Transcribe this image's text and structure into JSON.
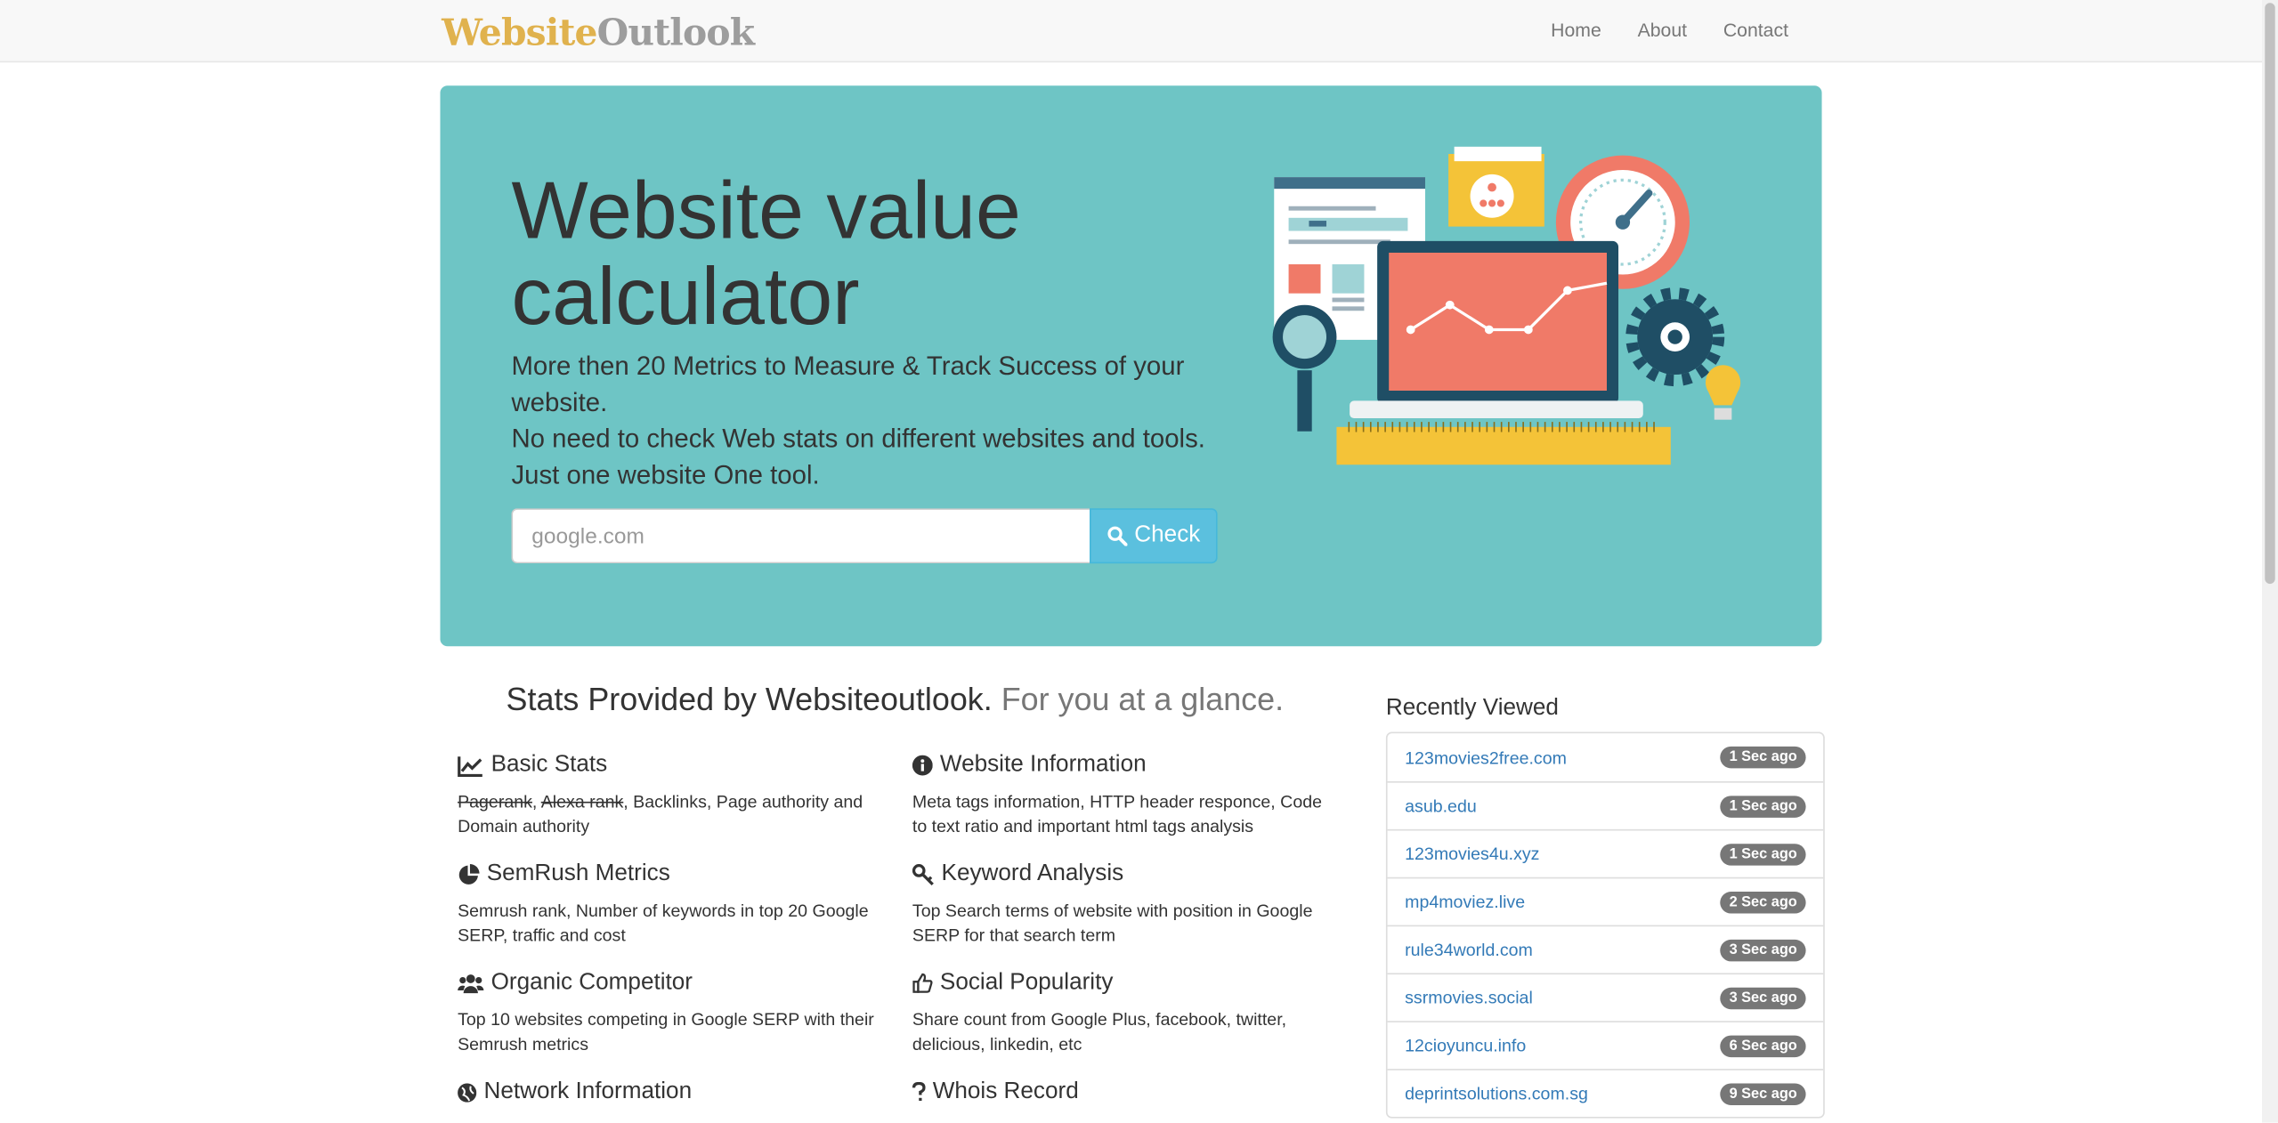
{
  "nav": {
    "brand_part1": "Website",
    "brand_part2": "Outlook",
    "links": [
      "Home",
      "About",
      "Contact"
    ]
  },
  "hero": {
    "title": "Website value calculator",
    "lines": [
      "More then 20 Metrics to Measure & Track Success of your website.",
      "No need to check Web stats on different websites and tools.",
      "Just one website One tool."
    ],
    "search_placeholder": "google.com",
    "check_label": "Check"
  },
  "stats": {
    "heading": "Stats Provided by Websiteoutlook.",
    "heading_muted": "For you at a glance.",
    "features": [
      {
        "title": "Basic Stats",
        "icon": "chart-line-icon",
        "strike1": "Pagerank",
        "strike2": "Alexa rank",
        "text": ", Backlinks, Page authority and Domain authority"
      },
      {
        "title": "Website Information",
        "icon": "info-circle-icon",
        "text": "Meta tags information, HTTP header responce, Code to text ratio and important html tags analysis"
      },
      {
        "title": "SemRush Metrics",
        "icon": "pie-chart-icon",
        "text": "Semrush rank, Number of keywords in top 20 Google SERP, traffic and cost"
      },
      {
        "title": "Keyword Analysis",
        "icon": "key-icon",
        "text": "Top Search terms of website with position in Google SERP for that search term"
      },
      {
        "title": "Organic Competitor",
        "icon": "users-icon",
        "text": "Top 10 websites competing in Google SERP with their Semrush metrics"
      },
      {
        "title": "Social Popularity",
        "icon": "thumbs-up-icon",
        "text": "Share count from Google Plus, facebook, twitter, delicious, linkedin, etc"
      },
      {
        "title": "Network Information",
        "icon": "globe-icon",
        "text": ""
      },
      {
        "title": "Whois Record",
        "icon": "question-icon",
        "text": ""
      }
    ]
  },
  "recent": {
    "title": "Recently Viewed",
    "items": [
      {
        "site": "123movies2free.com",
        "ago": "1 Sec ago"
      },
      {
        "site": "asub.edu",
        "ago": "1 Sec ago"
      },
      {
        "site": "123movies4u.xyz",
        "ago": "1 Sec ago"
      },
      {
        "site": "mp4moviez.live",
        "ago": "2 Sec ago"
      },
      {
        "site": "rule34world.com",
        "ago": "3 Sec ago"
      },
      {
        "site": "ssrmovies.social",
        "ago": "3 Sec ago"
      },
      {
        "site": "12cioyuncu.info",
        "ago": "6 Sec ago"
      },
      {
        "site": "deprintsolutions.com.sg",
        "ago": "9 Sec ago"
      }
    ]
  },
  "colors": {
    "hero_bg": "#6ec5c5",
    "brand_gold": "#e0b24e",
    "brand_gray": "#9d9d9d",
    "button": "#5bc0de",
    "link": "#337ab7",
    "badge": "#777777"
  }
}
